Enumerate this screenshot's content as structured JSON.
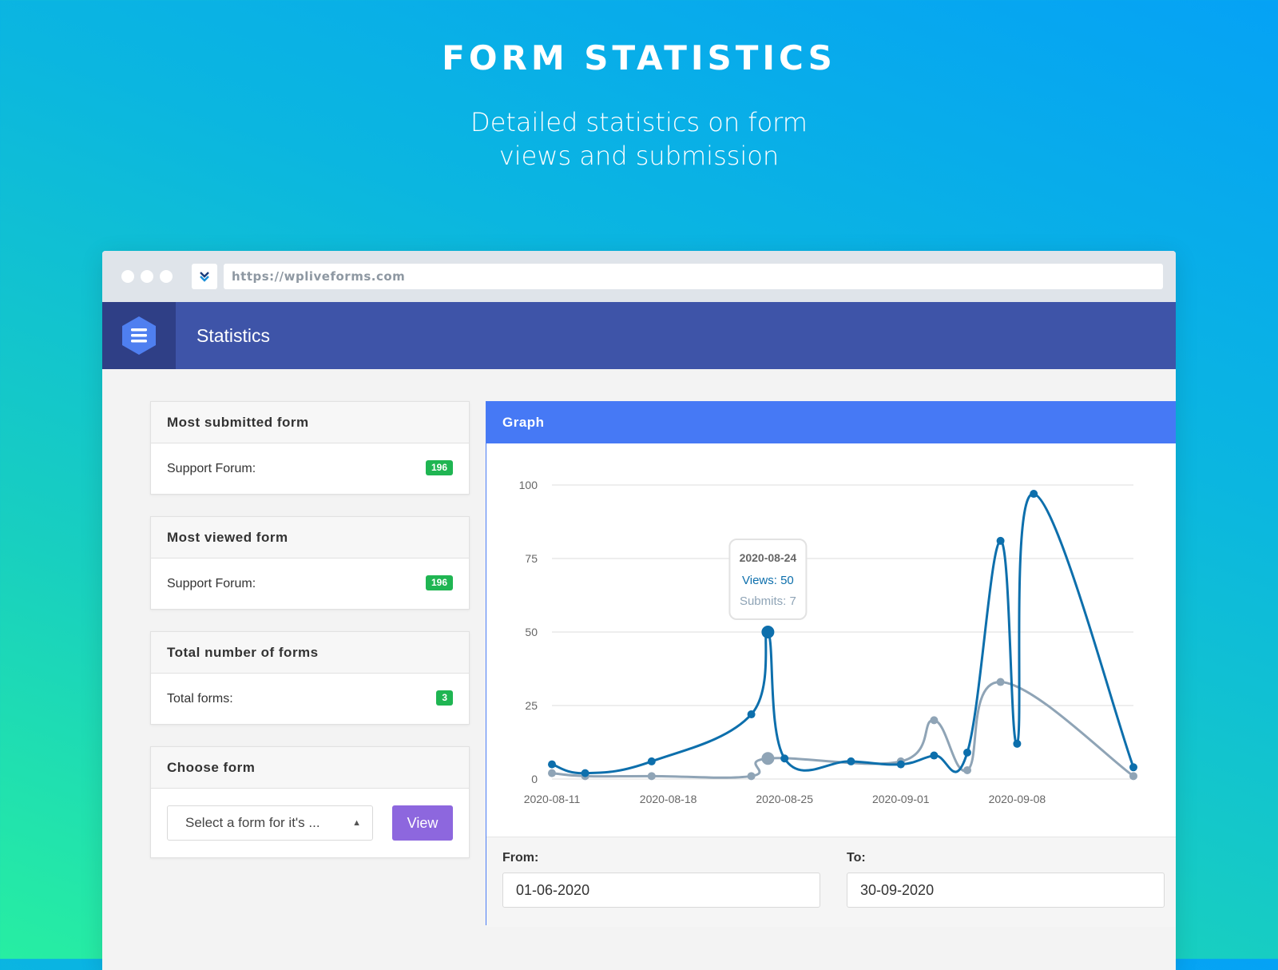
{
  "hero": {
    "title": "form statistics",
    "subtitle": "Detailed statistics on form views and submission"
  },
  "browser": {
    "url": "https://wpliveforms.com"
  },
  "header": {
    "title": "Statistics"
  },
  "cards": {
    "most_submitted": {
      "title": "Most submitted form",
      "label": "Support Forum:",
      "count": "196"
    },
    "most_viewed": {
      "title": "Most viewed form",
      "label": "Support Forum:",
      "count": "196"
    },
    "total_forms": {
      "title": "Total number of forms",
      "label": "Total forms:",
      "count": "3"
    },
    "choose_form": {
      "title": "Choose form",
      "select_value": "Select a form for it's ...",
      "view_label": "View"
    }
  },
  "graph": {
    "title": "Graph",
    "from_label": "From:",
    "to_label": "To:",
    "from_value": "01-06-2020",
    "to_value": "30-09-2020",
    "tooltip": {
      "date": "2020-08-24",
      "views": "Views: 50",
      "submits": "Submits: 7"
    }
  },
  "colors": {
    "views": "#0d6fac",
    "submits": "#8fa4b6",
    "header": "#3e54a8",
    "graph_header": "#4679f5",
    "badge": "#1fb552",
    "view_button": "#8d67de"
  },
  "chart_data": {
    "type": "line",
    "ylim": [
      0,
      100
    ],
    "yticks": [
      0,
      25,
      50,
      75,
      100
    ],
    "xlim": [
      "2020-08-11",
      "2020-09-15"
    ],
    "xticks": [
      "2020-08-11",
      "2020-08-18",
      "2020-08-25",
      "2020-09-01",
      "2020-09-08"
    ],
    "grid": true,
    "series": [
      {
        "name": "Views",
        "points": [
          [
            "2020-08-11",
            5
          ],
          [
            "2020-08-13",
            2
          ],
          [
            "2020-08-17",
            6
          ],
          [
            "2020-08-23",
            22
          ],
          [
            "2020-08-24",
            50
          ],
          [
            "2020-08-25",
            7
          ],
          [
            "2020-08-29",
            6
          ],
          [
            "2020-09-01",
            5
          ],
          [
            "2020-09-03",
            8
          ],
          [
            "2020-09-05",
            9
          ],
          [
            "2020-09-07",
            81
          ],
          [
            "2020-09-08",
            12
          ],
          [
            "2020-09-09",
            97
          ],
          [
            "2020-09-15",
            4
          ]
        ]
      },
      {
        "name": "Submits",
        "points": [
          [
            "2020-08-11",
            2
          ],
          [
            "2020-08-13",
            1
          ],
          [
            "2020-08-17",
            1
          ],
          [
            "2020-08-23",
            1
          ],
          [
            "2020-08-24",
            7
          ],
          [
            "2020-09-01",
            6
          ],
          [
            "2020-09-03",
            20
          ],
          [
            "2020-09-05",
            3
          ],
          [
            "2020-09-07",
            33
          ],
          [
            "2020-09-15",
            1
          ]
        ]
      }
    ]
  }
}
